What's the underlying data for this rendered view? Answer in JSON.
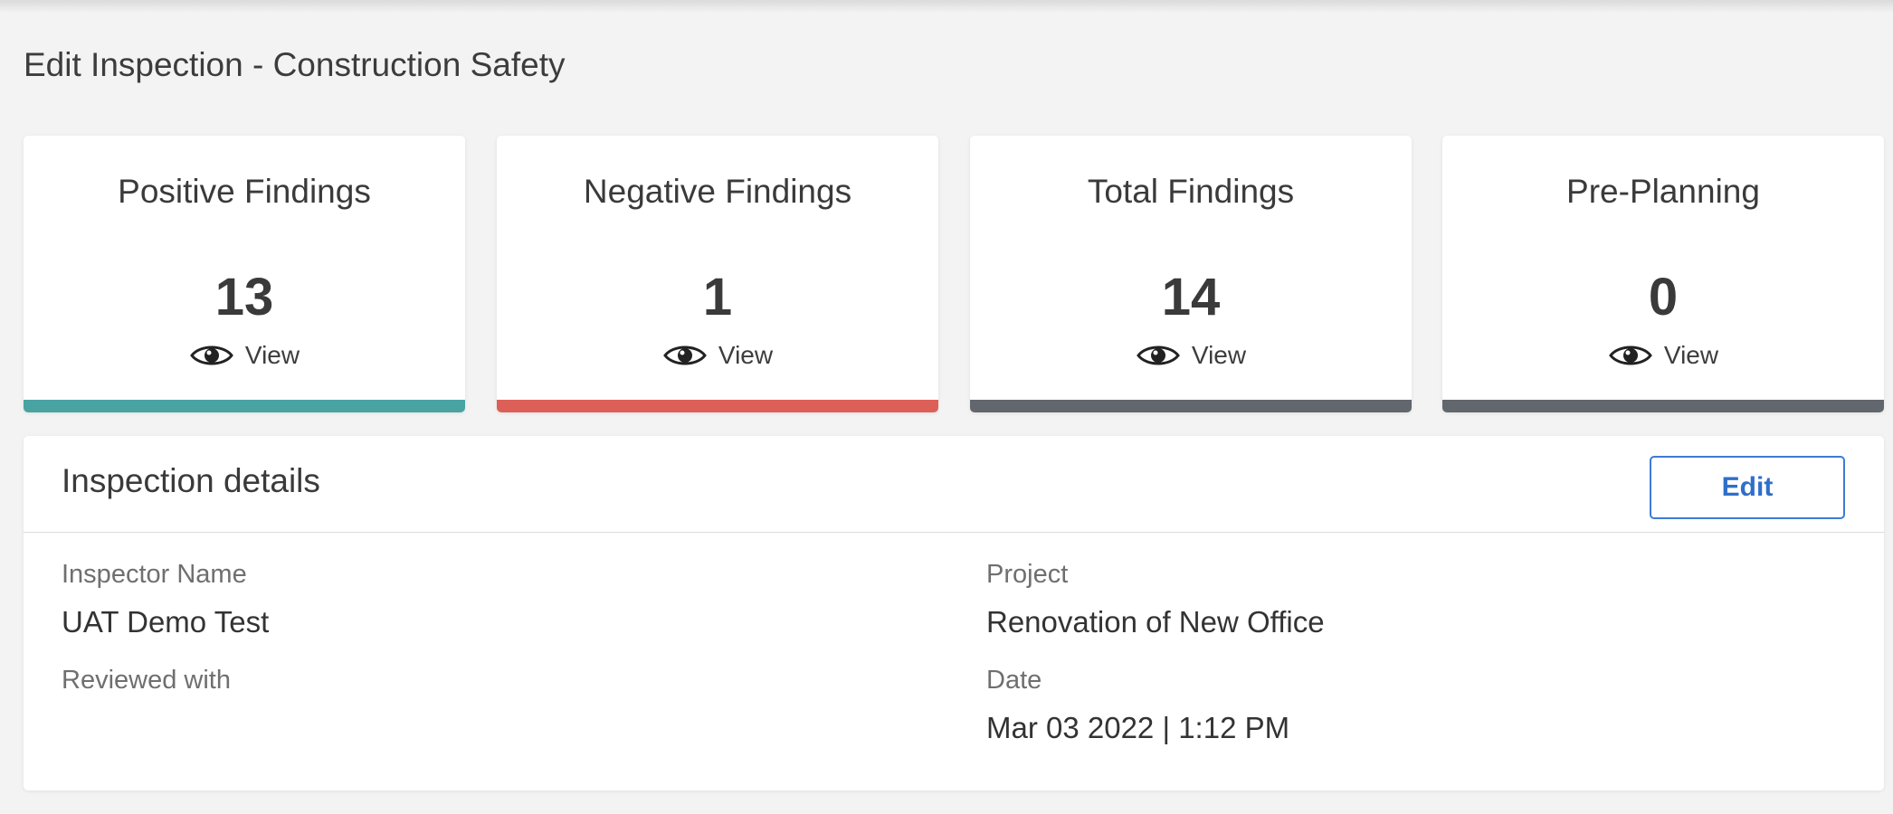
{
  "page": {
    "title": "Edit Inspection - Construction Safety"
  },
  "summary_cards": [
    {
      "title": "Positive Findings",
      "count": "13",
      "view_label": "View",
      "accent_color": "#4aa3a3"
    },
    {
      "title": "Negative Findings",
      "count": "1",
      "view_label": "View",
      "accent_color": "#dd6058"
    },
    {
      "title": "Total Findings",
      "count": "14",
      "view_label": "View",
      "accent_color": "#62666d"
    },
    {
      "title": "Pre-Planning",
      "count": "0",
      "view_label": "View",
      "accent_color": "#62666d"
    }
  ],
  "view_icon": "eye-icon",
  "details": {
    "title": "Inspection details",
    "edit_label": "Edit",
    "inspector_name_label": "Inspector Name",
    "inspector_name_value": "UAT Demo Test",
    "reviewed_with_label": "Reviewed with",
    "reviewed_with_value": "",
    "project_label": "Project",
    "project_value": "Renovation of New Office",
    "date_label": "Date",
    "date_value": "Mar 03 2022 | 1:12 PM"
  },
  "colors": {
    "background": "#f3f3f3",
    "edit_button": "#3d7bd4"
  }
}
